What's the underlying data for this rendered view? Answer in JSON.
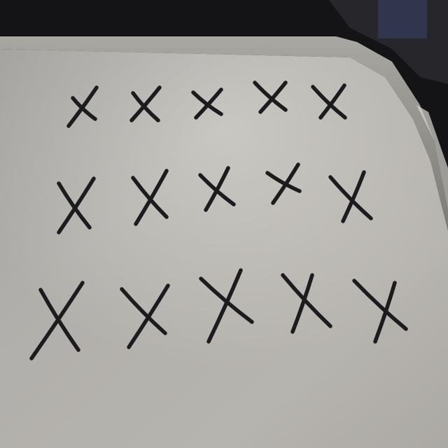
{
  "scene": {
    "description_colors": {
      "background_dark": "#141416",
      "board_surface": "#c9c7c2",
      "board_frame": "#8e8c86",
      "marker_ink": "#1c1c1f"
    },
    "marks": {
      "rows": [
        {
          "row": 1,
          "count": 5,
          "symbol": "X"
        },
        {
          "row": 2,
          "count": 5,
          "symbol": "X"
        },
        {
          "row": 3,
          "count": 5,
          "symbol": "X"
        }
      ],
      "total": 15
    }
  }
}
